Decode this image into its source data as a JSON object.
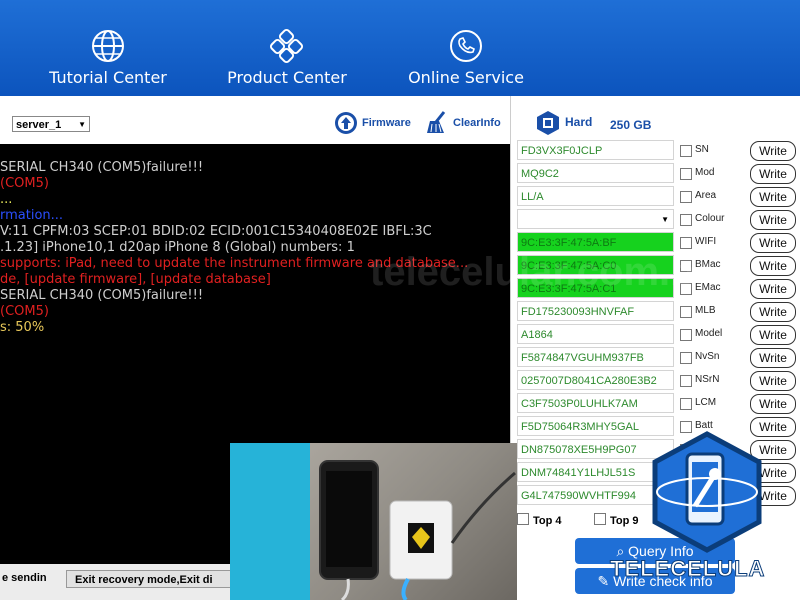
{
  "nav": {
    "items": [
      {
        "label": "Tutorial Center",
        "icon": "globe-icon"
      },
      {
        "label": "Product Center",
        "icon": "grid-icon"
      },
      {
        "label": "Online Service",
        "icon": "phone-icon"
      }
    ]
  },
  "toolbar": {
    "server_value": "server_1",
    "firmware_label": "Firmware",
    "clearinfo_label": "ClearInfo"
  },
  "console": {
    "lines": [
      {
        "text": "SERIAL CH340 (COM5)failure!!!",
        "color": "#cfcfcf"
      },
      {
        "text": "(COM5)",
        "color": "#e02020"
      },
      {
        "text": "...",
        "color": "#e8e85a"
      },
      {
        "text": "rmation...",
        "color": "#2a4fff"
      },
      {
        "text": "V:11 CPFM:03 SCEP:01 BDID:02 ECID:001C15340408E02E IBFL:3C",
        "color": "#cfcfcf"
      },
      {
        "text": ".1.23] iPhone10,1 d20ap iPhone 8 (Global) numbers: 1",
        "color": "#cfcfcf"
      },
      {
        "text": "supports: iPad, need to update the instrument firmware and database...",
        "color": "#e02020"
      },
      {
        "text": "de, [update firmware], [update database]",
        "color": "#e02020"
      },
      {
        "text": "SERIAL CH340 (COM5)failure!!!",
        "color": "#cfcfcf"
      },
      {
        "text": "(COM5)",
        "color": "#e02020"
      },
      {
        "text": "s: 50%",
        "color": "#e8c85a"
      }
    ]
  },
  "bottom": {
    "label": "e sendin",
    "button": "Exit recovery mode,Exit di"
  },
  "hard": {
    "label": "Hard",
    "size": "250 GB"
  },
  "rows": [
    {
      "value": "FD3VX3F0JCLP",
      "label": "SN",
      "style": "text"
    },
    {
      "value": "MQ9C2",
      "label": "Mod",
      "style": "text"
    },
    {
      "value": "LL/A",
      "label": "Area",
      "style": "text"
    },
    {
      "value": "",
      "label": "Colour",
      "style": "select"
    },
    {
      "value": "9C:E3:3F:47:5A:BF",
      "label": "WIFI",
      "style": "green"
    },
    {
      "value": "9C:E3:3F:47:5A:C0",
      "label": "BMac",
      "style": "green"
    },
    {
      "value": "9C:E3:3F:47:5A:C1",
      "label": "EMac",
      "style": "green"
    },
    {
      "value": "FD175230093HNVFAF",
      "label": "MLB",
      "style": "text"
    },
    {
      "value": "A1864",
      "label": "Model",
      "style": "text"
    },
    {
      "value": "F5874847VGUHM937FB",
      "label": "NvSn",
      "style": "text"
    },
    {
      "value": "0257007D8041CA280E3B2",
      "label": "NSrN",
      "style": "text"
    },
    {
      "value": "C3F7503P0LUHLK7AM",
      "label": "LCM",
      "style": "text"
    },
    {
      "value": "F5D75064R3MHY5GAL",
      "label": "Batt",
      "style": "text"
    },
    {
      "value": "DN875078XE5H9PG07",
      "label": "",
      "style": "text"
    },
    {
      "value": "DNM74841Y1LHJL51S",
      "label": "",
      "style": "text"
    },
    {
      "value": "G4L747590WVHTF994",
      "label": "",
      "style": "text"
    }
  ],
  "write_label": "Write",
  "top4_label": "Top 4",
  "top9_label": "Top 9",
  "query_label": "Query Info",
  "writecheck_label": "Write check info",
  "watermark_text": "telecelular.com.br",
  "logo_text": "TELECELULA",
  "colors": {
    "nav_blue": "#1f6fd6",
    "console_bg": "#000000",
    "mac_green": "#16d21e",
    "text_green": "#2d8a2d"
  }
}
